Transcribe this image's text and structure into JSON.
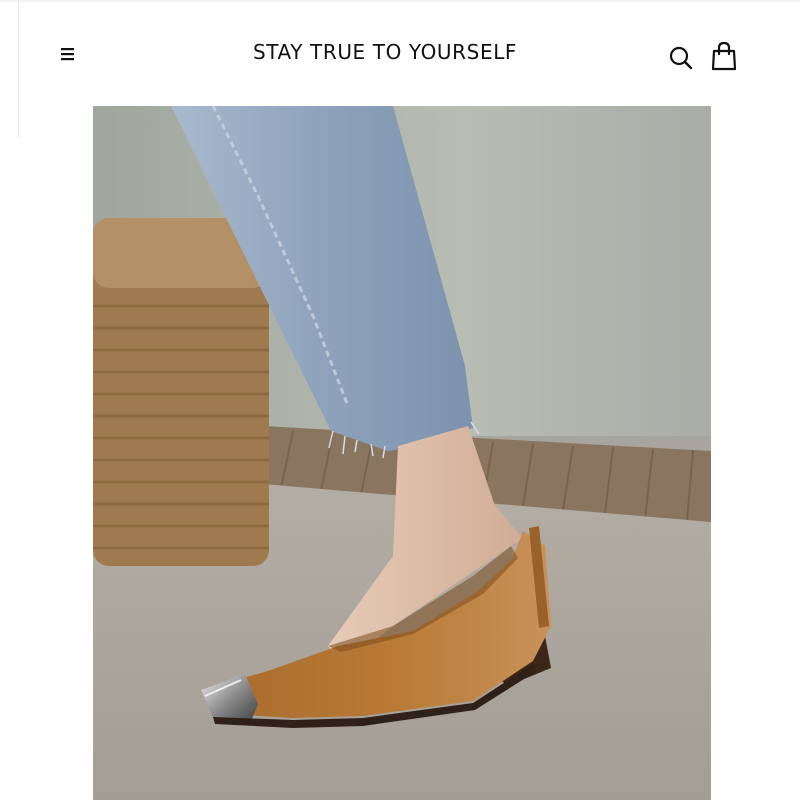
{
  "header": {
    "brand_title": "STAY TRUE TO YOURSELF",
    "menu_icon": "hamburger-menu-icon",
    "search_icon": "search-icon",
    "cart_icon": "shopping-bag-icon"
  },
  "hero": {
    "subject": "product-photo-brown-leather-flat-shoe-with-metal-toe-cap"
  },
  "colors": {
    "background": "#ffffff",
    "text": "#111111",
    "shoe_tan": "#b5772f",
    "denim": "#8ea2bc"
  }
}
